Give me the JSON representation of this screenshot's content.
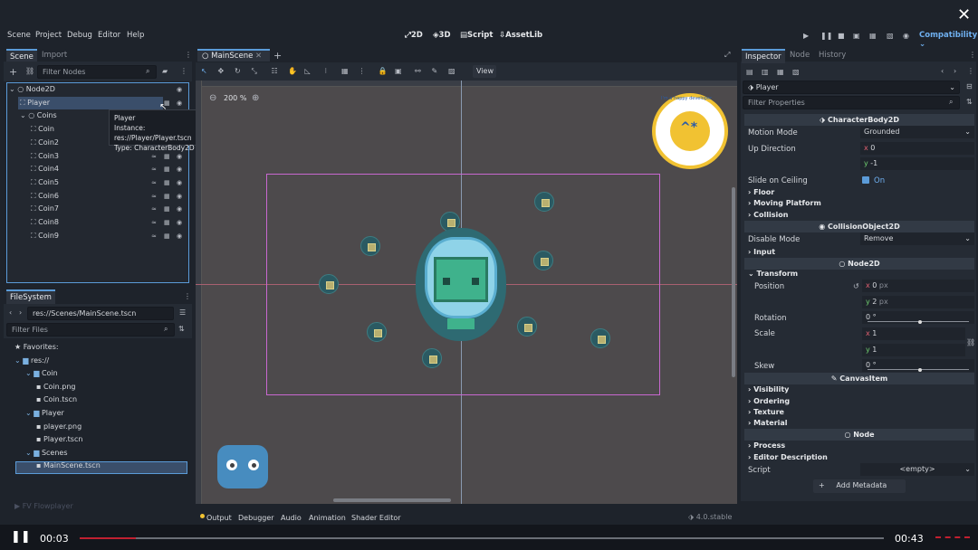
{
  "menu": [
    "Scene",
    "Project",
    "Debug",
    "Editor",
    "Help"
  ],
  "workspaces": [
    "2D",
    "3D",
    "Script",
    "AssetLib"
  ],
  "renderer": "Compatibility",
  "scene_dock": {
    "tabs": [
      "Scene",
      "Import"
    ],
    "filter_placeholder": "Filter Nodes",
    "nodes": [
      {
        "label": "Node2D",
        "indent": 0
      },
      {
        "label": "Player",
        "indent": 1
      },
      {
        "label": "Coins",
        "indent": 1
      },
      {
        "label": "Coin",
        "indent": 2
      },
      {
        "label": "Coin2",
        "indent": 2
      },
      {
        "label": "Coin3",
        "indent": 2
      },
      {
        "label": "Coin4",
        "indent": 2
      },
      {
        "label": "Coin5",
        "indent": 2
      },
      {
        "label": "Coin6",
        "indent": 2
      },
      {
        "label": "Coin7",
        "indent": 2
      },
      {
        "label": "Coin8",
        "indent": 2
      },
      {
        "label": "Coin9",
        "indent": 2
      }
    ]
  },
  "tooltip": {
    "line1": "Player",
    "line2": "Instance: res://Player/Player.tscn",
    "line3": "Type: CharacterBody2D"
  },
  "filesystem": {
    "tab": "FileSystem",
    "path": "res://Scenes/MainScene.tscn",
    "filter_placeholder": "Filter Files",
    "items": [
      {
        "label": "Favorites:",
        "indent": 0
      },
      {
        "label": "res://",
        "indent": 0
      },
      {
        "label": "Coin",
        "indent": 1
      },
      {
        "label": "Coin.png",
        "indent": 2
      },
      {
        "label": "Coin.tscn",
        "indent": 2
      },
      {
        "label": "Player",
        "indent": 1
      },
      {
        "label": "player.png",
        "indent": 2
      },
      {
        "label": "Player.tscn",
        "indent": 2
      },
      {
        "label": "Scenes",
        "indent": 1
      },
      {
        "label": "MainScene.tscn",
        "indent": 2
      }
    ]
  },
  "editor": {
    "tab": "MainScene",
    "zoom": "200 %",
    "view_label": "View",
    "sticker": "I'm a happy developer"
  },
  "bottom": {
    "tabs": [
      "Output",
      "Debugger",
      "Audio",
      "Animation",
      "Shader Editor"
    ],
    "version": "4.0.stable"
  },
  "inspector": {
    "tabs": [
      "Inspector",
      "Node",
      "History"
    ],
    "node": "Player",
    "filter_placeholder": "Filter Properties",
    "sec_body": "CharacterBody2D",
    "motion_mode_label": "Motion Mode",
    "motion_mode": "Grounded",
    "up_dir_label": "Up Direction",
    "up_x": "0",
    "up_y": "-1",
    "slide_label": "Slide on Ceiling",
    "slide_value": "On",
    "floor": "Floor",
    "moving_platform": "Moving Platform",
    "collision": "Collision",
    "sec_collobj": "CollisionObject2D",
    "disable_mode_label": "Disable Mode",
    "disable_mode": "Remove",
    "input": "Input",
    "sec_node2d": "Node2D",
    "transform": "Transform",
    "position_label": "Position",
    "pos_x": "0",
    "pos_y": "2",
    "px": "px",
    "rotation_label": "Rotation",
    "rotation": "0 °",
    "scale_label": "Scale",
    "scale_x": "1",
    "scale_y": "1",
    "skew_label": "Skew",
    "skew": "0 °",
    "sec_canvas": "CanvasItem",
    "visibility": "Visibility",
    "ordering": "Ordering",
    "texture": "Texture",
    "material": "Material",
    "sec_node": "Node",
    "process": "Process",
    "editor_description": "Editor Description",
    "script_label": "Script",
    "script_value": "<empty>",
    "add_metadata": "Add Metadata"
  },
  "player": {
    "current": "00:03",
    "total": "00:43",
    "brand": "FV Flowplayer",
    "progress": 0.07
  }
}
